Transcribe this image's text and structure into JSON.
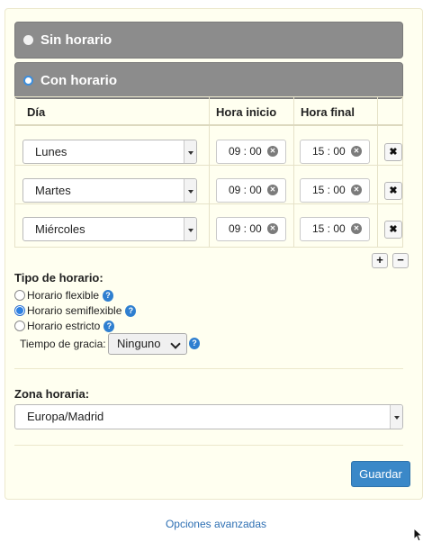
{
  "options": {
    "no_schedule": "Sin horario",
    "with_schedule": "Con horario"
  },
  "schedule": {
    "headers": {
      "day": "Día",
      "start": "Hora inicio",
      "end": "Hora final"
    },
    "rows": [
      {
        "day": "Lunes",
        "start": "09 : 00",
        "end": "15 : 00"
      },
      {
        "day": "Martes",
        "start": "09 : 00",
        "end": "15 : 00"
      },
      {
        "day": "Miércoles",
        "start": "09 : 00",
        "end": "15 : 00"
      }
    ],
    "add_label": "+",
    "remove_label": "−",
    "delete_label": "✖",
    "clear_glyph": "✕"
  },
  "schedule_type": {
    "title": "Tipo de horario:",
    "options": [
      {
        "label": "Horario flexible",
        "checked": false
      },
      {
        "label": "Horario semiflexible",
        "checked": true
      },
      {
        "label": "Horario estricto",
        "checked": false
      }
    ],
    "help_glyph": "?"
  },
  "grace": {
    "label": "Tiempo de gracia:",
    "value": "Ninguno"
  },
  "timezone": {
    "title": "Zona horaria:",
    "value": "Europa/Madrid"
  },
  "save_label": "Guardar",
  "advanced_label": "Opciones avanzadas",
  "colors": {
    "accent": "#3a88c8",
    "panel_bg": "#fffff0",
    "option_bar": "#8c8c8c"
  }
}
